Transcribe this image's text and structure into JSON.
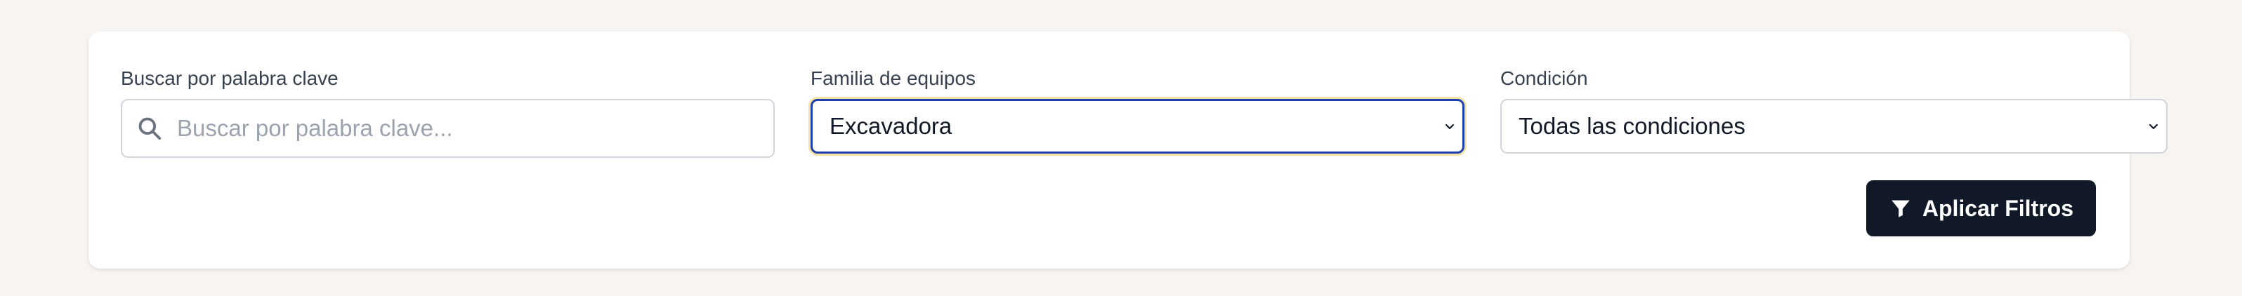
{
  "filters": {
    "keyword": {
      "label": "Buscar por palabra clave",
      "placeholder": "Buscar por palabra clave...",
      "value": "",
      "icon": "search-icon"
    },
    "family": {
      "label": "Familia de equipos",
      "selected": "Excavadora",
      "focused": true,
      "icon": "chevron-down-icon"
    },
    "condition": {
      "label": "Condición",
      "selected": "Todas las condiciones",
      "icon": "chevron-down-icon"
    }
  },
  "actions": {
    "apply_label": "Aplicar Filtros",
    "apply_icon": "filter-icon"
  },
  "colors": {
    "page_background": "#f8f4f2",
    "card_background": "#ffffff",
    "button_background": "#111827",
    "focus_border": "#1e40af",
    "focus_ring": "#f3e3a6",
    "placeholder_text": "#9ca3af"
  }
}
